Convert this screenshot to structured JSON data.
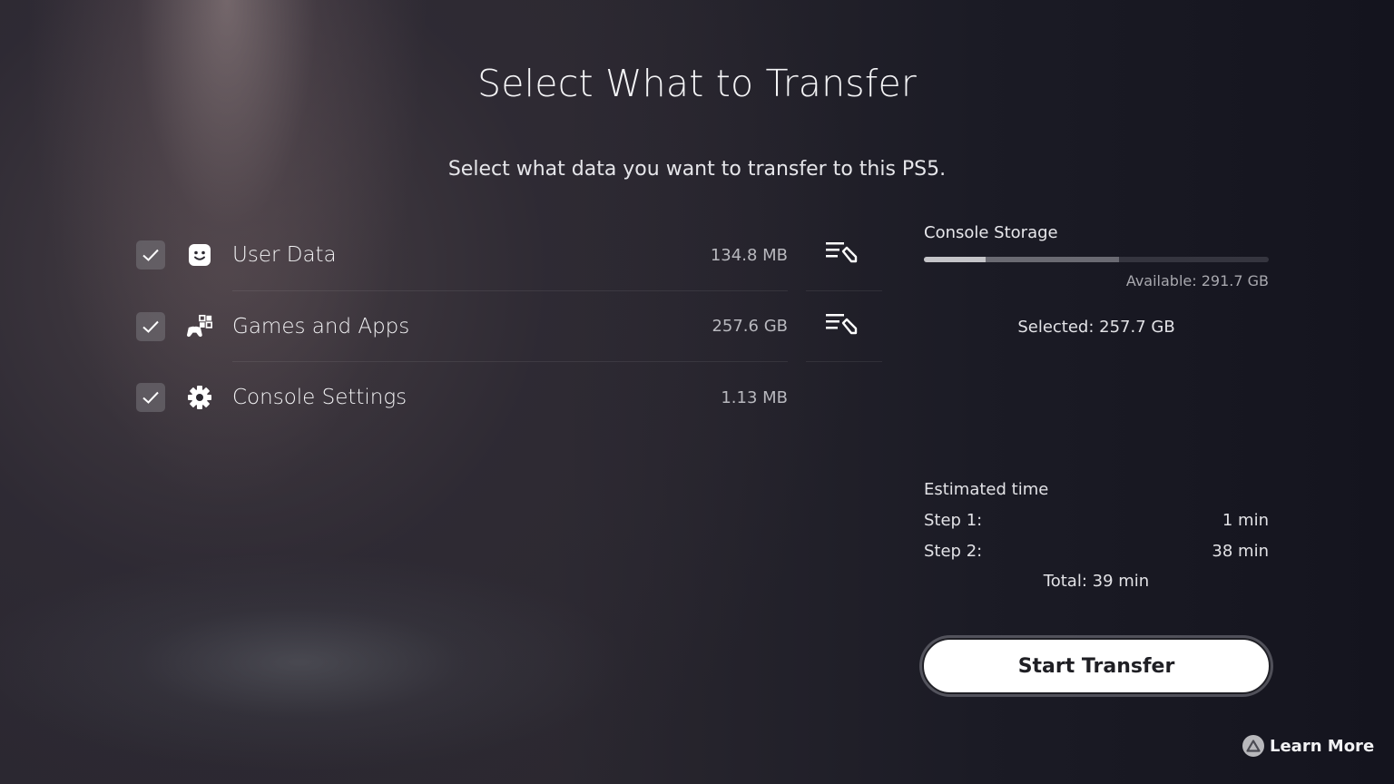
{
  "header": {
    "title": "Select What to Transfer",
    "subtitle": "Select what data you want to transfer to this PS5."
  },
  "items": [
    {
      "label": "User Data",
      "size": "134.8 MB",
      "checked": true,
      "icon": "user-face-icon",
      "editable": true
    },
    {
      "label": "Games and Apps",
      "size": "257.6 GB",
      "checked": true,
      "icon": "games-and-apps-icon",
      "editable": true
    },
    {
      "label": "Console Settings",
      "size": "1.13 MB",
      "checked": true,
      "icon": "gear-icon",
      "editable": false
    }
  ],
  "storage": {
    "label": "Console Storage",
    "available": "Available: 291.7 GB",
    "selected": "Selected: 257.7 GB",
    "used_fraction": 0.18,
    "selected_fraction": 0.385
  },
  "estimate": {
    "title": "Estimated time",
    "steps": [
      {
        "label": "Step 1:",
        "value": "1 min"
      },
      {
        "label": "Step 2:",
        "value": "38 min"
      }
    ],
    "total": "Total: 39 min"
  },
  "actions": {
    "start_transfer": "Start Transfer",
    "learn_more": "Learn More",
    "learn_more_icon": "triangle-button-icon"
  }
}
